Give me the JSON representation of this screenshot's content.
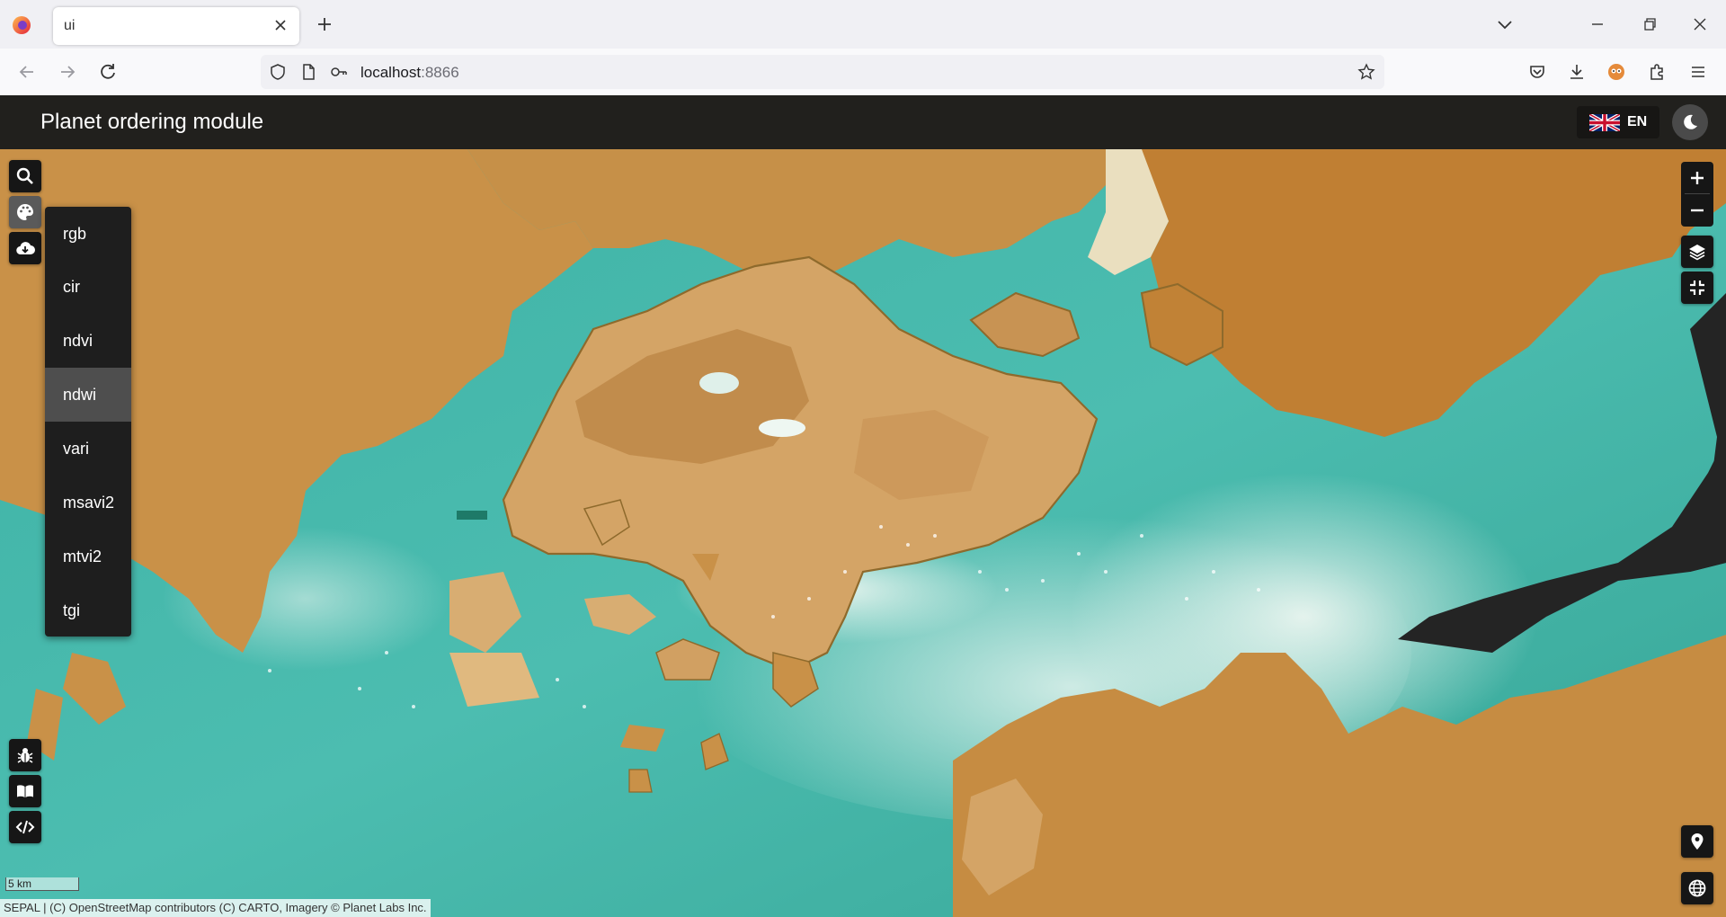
{
  "browser": {
    "tab_title": "ui",
    "url_host": "localhost",
    "url_port": ":8866"
  },
  "app": {
    "title": "Planet ordering module",
    "language": "EN"
  },
  "viz_menu": {
    "items": [
      "rgb",
      "cir",
      "ndvi",
      "ndwi",
      "vari",
      "msavi2",
      "mtvi2",
      "tgi"
    ],
    "selected": "ndwi"
  },
  "map": {
    "scale_label": "5 km",
    "attribution": "SEPAL | (C) OpenStreetMap contributors (C) CARTO, Imagery © Planet Labs Inc."
  },
  "icons": {
    "left_top": [
      "search-icon",
      "palette-icon",
      "cloud-download-icon"
    ],
    "left_bottom": [
      "bug-icon",
      "book-icon",
      "code-icon"
    ],
    "right": [
      "zoom-in-icon",
      "zoom-out-icon",
      "layers-icon",
      "fullscreen-exit-icon",
      "location-pin-icon",
      "globe-icon"
    ]
  },
  "colors": {
    "header_bg": "#21201d",
    "land": "#c48e43",
    "water": "#3eb2a6"
  }
}
